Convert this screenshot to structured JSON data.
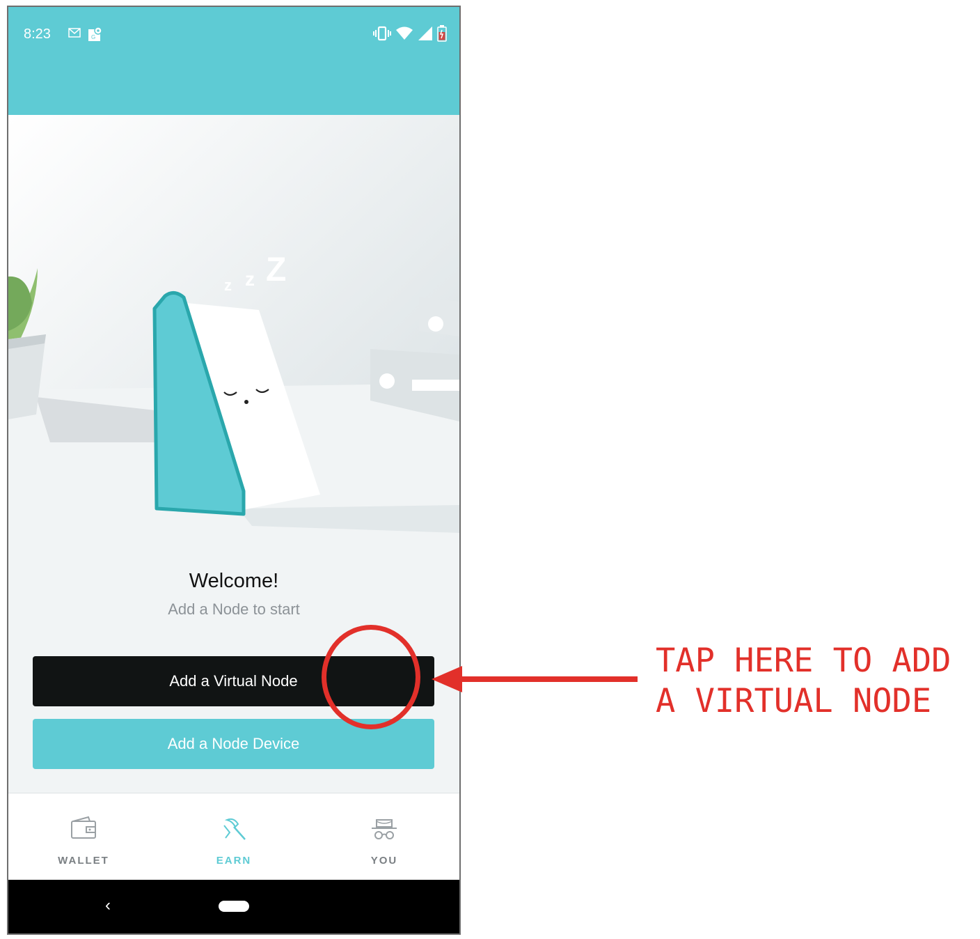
{
  "status_bar": {
    "time": "8:23",
    "background_color": "#5ecbd4",
    "notification_icons": [
      "gmail-icon",
      "maps-icon"
    ],
    "system_icons": [
      "vibrate-icon",
      "wifi-icon",
      "signal-icon",
      "battery-charging-icon"
    ]
  },
  "main": {
    "illustration": "sleeping-node-illustration",
    "welcome": "Welcome!",
    "subtitle": "Add a Node to start",
    "add_virtual_node_label": "Add a Virtual Node",
    "add_node_device_label": "Add a Node Device"
  },
  "bottom_nav": {
    "items": [
      {
        "label": "WALLET",
        "icon": "wallet-icon",
        "active": false
      },
      {
        "label": "EARN",
        "icon": "pickaxe-icon",
        "active": true
      },
      {
        "label": "YOU",
        "icon": "spy-hat-glasses-icon",
        "active": false
      }
    ]
  },
  "annotation": {
    "text": "TAP HERE TO ADD\nA VIRTUAL NODE",
    "color": "#e2302a"
  },
  "colors": {
    "accent": "#5ecbd4",
    "primary_button": "#111414",
    "annotation": "#e2302a"
  }
}
